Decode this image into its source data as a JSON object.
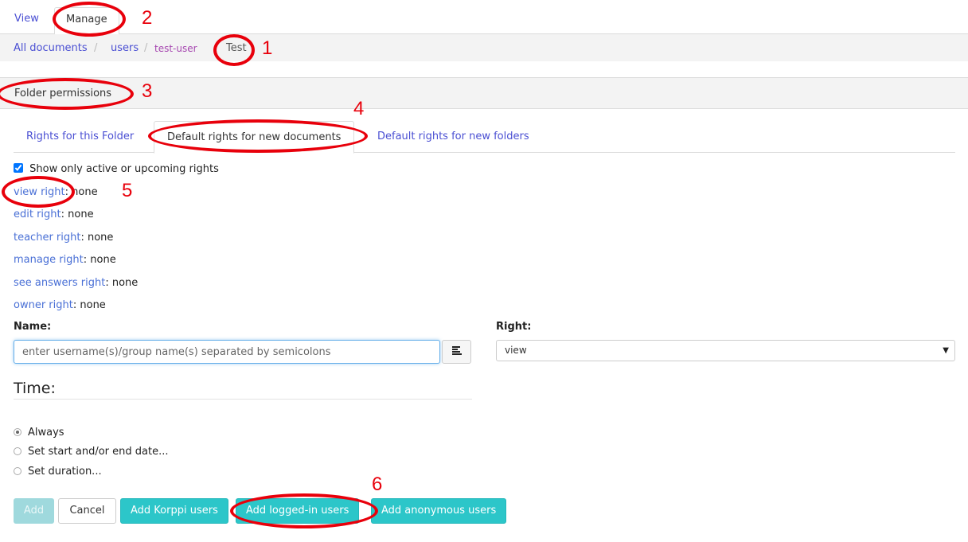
{
  "nav": {
    "view": "View",
    "manage": "Manage"
  },
  "breadcrumb": {
    "all_documents": "All documents",
    "users": "users",
    "user": "test-user",
    "current": "Test",
    "separator": "/"
  },
  "section": {
    "title": "Folder permissions"
  },
  "tabs": [
    {
      "label": "Rights for this Folder"
    },
    {
      "label": "Default rights for new documents"
    },
    {
      "label": "Default rights for new folders"
    }
  ],
  "filter": {
    "label": "Show only active or upcoming rights",
    "checked": true
  },
  "rights": [
    {
      "name": "view right",
      "value": ": none"
    },
    {
      "name": "edit right",
      "value": ": none"
    },
    {
      "name": "teacher right",
      "value": ": none"
    },
    {
      "name": "manage right",
      "value": ": none"
    },
    {
      "name": "see answers right",
      "value": ": none"
    },
    {
      "name": "owner right",
      "value": ": none"
    }
  ],
  "form": {
    "name_label": "Name:",
    "name_placeholder": "enter username(s)/group name(s) separated by semicolons",
    "right_label": "Right:",
    "right_value": "view",
    "time_label": "Time:",
    "time_options": [
      {
        "label": "Always",
        "selected": true
      },
      {
        "label": "Set start and/or end date...",
        "selected": false
      },
      {
        "label": "Set duration...",
        "selected": false
      }
    ]
  },
  "buttons": {
    "add": "Add",
    "cancel": "Cancel",
    "add_korppi": "Add Korppi users",
    "add_logged_in": "Add logged-in users",
    "add_anonymous": "Add anonymous users"
  },
  "annotations": [
    "1",
    "2",
    "3",
    "4",
    "5",
    "6"
  ],
  "colors": {
    "link": "#4a4fd3",
    "accent": "#2cc6c9",
    "annotation": "#e8000b"
  }
}
